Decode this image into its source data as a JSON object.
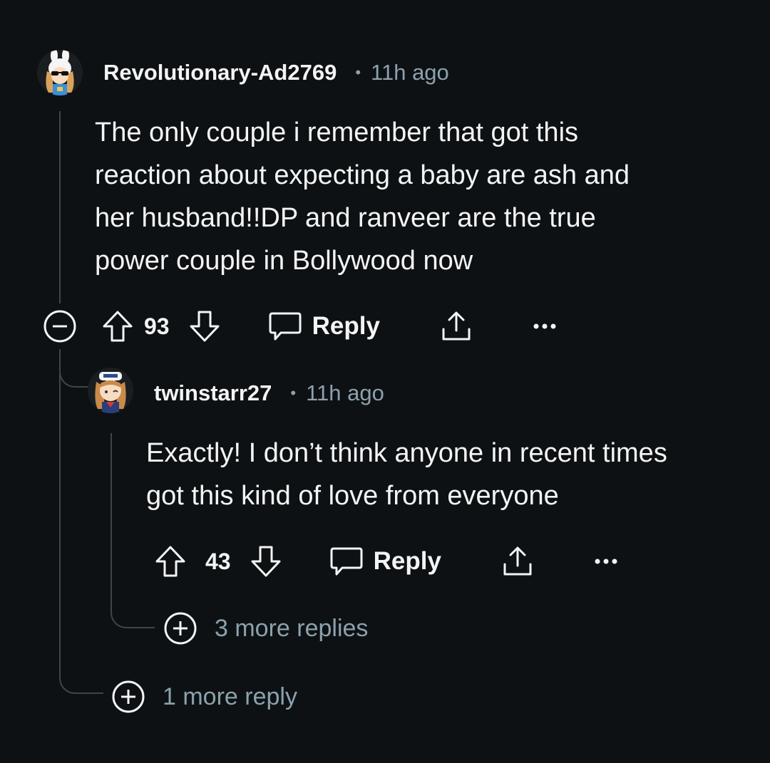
{
  "colors": {
    "background": "#0e1113",
    "text": "#f2f4f5",
    "muted": "#8ba2ad",
    "thread_line": "#3e4548"
  },
  "comment": {
    "username": "Revolutionary-Ad2769",
    "separator": "•",
    "time": "11h ago",
    "body_lines": [
      "The only couple i remember that got this",
      "reaction about expecting a baby are ash and",
      "her husband!!DP and ranveer are the true",
      "power couple in Bollywood now"
    ],
    "votes": "93",
    "reply_label": "Reply",
    "icons": [
      "collapse-icon",
      "upvote-icon",
      "downvote-icon",
      "chat-bubble-icon",
      "share-icon",
      "more-options-icon"
    ]
  },
  "reply": {
    "username": "twinstarr27",
    "separator": "•",
    "time": "11h ago",
    "body_lines": [
      "Exactly! I don’t think anyone in recent times",
      "got this kind of love from everyone"
    ],
    "votes": "43",
    "reply_label": "Reply",
    "more_replies": "3 more replies",
    "icons": [
      "upvote-icon",
      "downvote-icon",
      "chat-bubble-icon",
      "share-icon",
      "more-options-icon",
      "expand-plus-icon"
    ]
  },
  "thread": {
    "more_replies": "1 more reply"
  }
}
